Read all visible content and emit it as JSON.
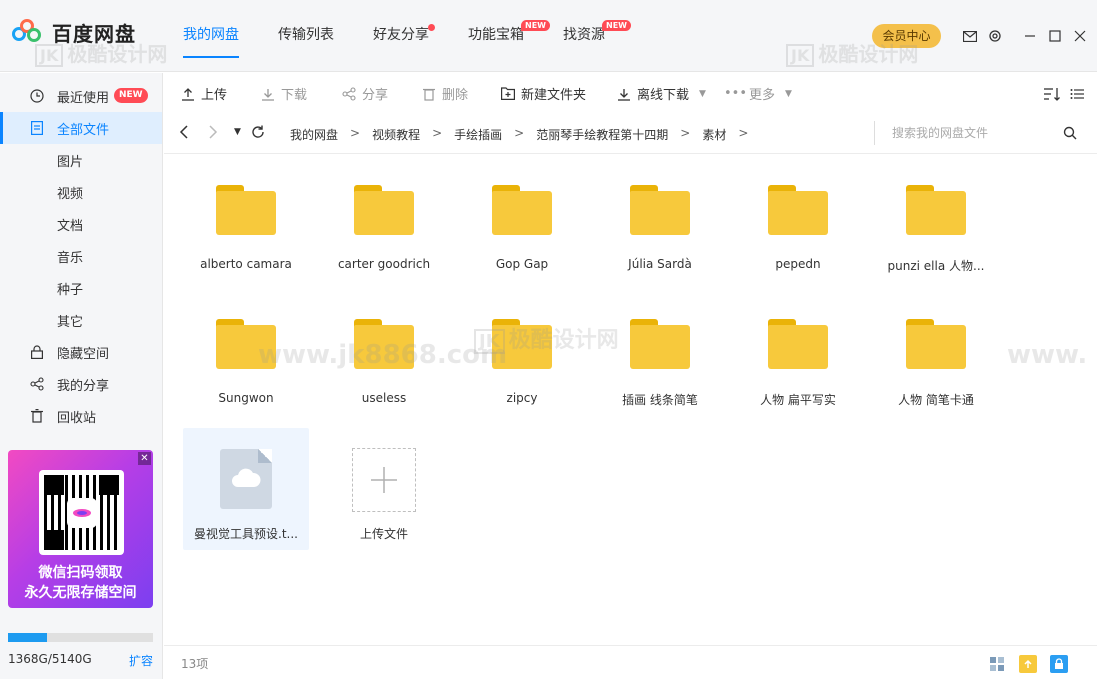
{
  "app": {
    "name": "百度网盘",
    "tabs": [
      {
        "label": "我的网盘",
        "active": true
      },
      {
        "label": "传输列表"
      },
      {
        "label": "好友分享",
        "dot": true
      },
      {
        "label": "功能宝箱",
        "badge": "NEW"
      },
      {
        "label": "找资源",
        "badge": "NEW"
      }
    ],
    "vip_label": "会员中心",
    "accent": "#0a84ff"
  },
  "sidebar": {
    "items": [
      {
        "label": "最近使用",
        "icon": "clock-icon",
        "badge": "NEW"
      },
      {
        "label": "全部文件",
        "icon": "document-icon",
        "active": true
      },
      {
        "label": "图片"
      },
      {
        "label": "视频"
      },
      {
        "label": "文档"
      },
      {
        "label": "音乐"
      },
      {
        "label": "种子"
      },
      {
        "label": "其它"
      },
      {
        "label": "隐藏空间",
        "icon": "lock-icon"
      },
      {
        "label": "我的分享",
        "icon": "share-icon"
      },
      {
        "label": "回收站",
        "icon": "trash-icon"
      }
    ],
    "promo": {
      "line1": "微信扫码领取",
      "line2": "永久无限存储空间"
    },
    "storage": {
      "used_text": "1368G/5140G",
      "used_fraction": 0.266,
      "expand_label": "扩容"
    }
  },
  "toolbar": {
    "upload": "上传",
    "download": "下载",
    "share": "分享",
    "delete": "删除",
    "new_folder": "新建文件夹",
    "offline_download": "离线下载",
    "more": "更多"
  },
  "breadcrumb": {
    "items": [
      "我的网盘",
      "视频教程",
      "手绘插画",
      "范丽琴手绘教程第十四期",
      "素材"
    ],
    "separator": ">",
    "search_placeholder": "搜索我的网盘文件"
  },
  "files": [
    {
      "name": "alberto camara",
      "type": "folder"
    },
    {
      "name": "carter goodrich",
      "type": "folder"
    },
    {
      "name": "Gop Gap",
      "type": "folder"
    },
    {
      "name": "Júlia Sardà",
      "type": "folder"
    },
    {
      "name": "pepedn",
      "type": "folder"
    },
    {
      "name": "punzi ella 人物...",
      "type": "folder"
    },
    {
      "name": "Sungwon",
      "type": "folder"
    },
    {
      "name": "useless",
      "type": "folder"
    },
    {
      "name": "zipcy",
      "type": "folder"
    },
    {
      "name": "插画 线条简笔",
      "type": "folder"
    },
    {
      "name": "人物 扁平写实",
      "type": "folder"
    },
    {
      "name": "人物 简笔卡通",
      "type": "folder"
    },
    {
      "name": "曼视觉工具预设.t...",
      "type": "file"
    }
  ],
  "upload_tile_label": "上传文件",
  "status": {
    "count": "13项"
  },
  "watermark": {
    "brand": "极酷设计网",
    "url": "www.jk8868.com"
  }
}
